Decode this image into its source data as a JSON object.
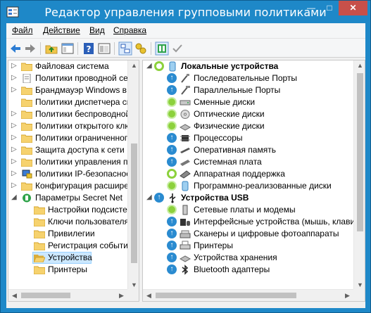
{
  "window": {
    "title": "Редактор управления групповыми политиками",
    "controls": {
      "minimize": "—",
      "maximize": "□",
      "close": "✕"
    },
    "colors": {
      "frame": "#1e88c8",
      "close": "#c7504a",
      "selection": "#cce8ff"
    }
  },
  "menubar": {
    "file": "Файл",
    "action": "Действие",
    "view": "Вид",
    "help": "Справка"
  },
  "toolbar": {
    "icons": [
      "back-arrow-icon",
      "forward-arrow-icon",
      "up-folder-icon",
      "show-hide-tree-icon",
      "help-icon",
      "properties-icon",
      "policy-tree-icon",
      "key-filter-icon",
      "view-toggle-icon",
      "checkmark-icon"
    ]
  },
  "left_tree": {
    "items": [
      {
        "label": "Файловая система",
        "expandable": true
      },
      {
        "label": "Политики проводной сети",
        "expandable": true
      },
      {
        "label": "Брандмауэр Windows в режиме повышенной безопасности",
        "expandable": true
      },
      {
        "label": "Политики диспетчера списков сетей",
        "expandable": false
      },
      {
        "label": "Политики беспроводной сети",
        "expandable": true
      },
      {
        "label": "Политики открытого ключа",
        "expandable": true
      },
      {
        "label": "Политики ограниченного использования программ",
        "expandable": true
      },
      {
        "label": "Защита доступа к сети",
        "expandable": true
      },
      {
        "label": "Политики управления приложениями",
        "expandable": true
      },
      {
        "label": "Политики IP-безопасности",
        "expandable": true
      },
      {
        "label": "Конфигурация расширенной политики аудита",
        "expandable": true
      },
      {
        "label": "Параметры Secret Net",
        "expandable": true,
        "expanded": true
      },
      {
        "label": "Настройки подсистем",
        "child": true
      },
      {
        "label": "Ключи пользователя",
        "child": true
      },
      {
        "label": "Привилегии",
        "child": true
      },
      {
        "label": "Регистрация событий",
        "child": true
      },
      {
        "label": "Устройства",
        "child": true,
        "selected": true
      },
      {
        "label": "Принтеры",
        "child": true
      }
    ]
  },
  "right_tree": {
    "items": [
      {
        "label": "Локальные устройства",
        "header": true,
        "status": "greenring",
        "icon": "local-devices-icon"
      },
      {
        "label": "Последовательные Порты",
        "status": "blue",
        "icon": "serial-port-icon"
      },
      {
        "label": "Параллельные Порты",
        "status": "blue",
        "icon": "parallel-port-icon"
      },
      {
        "label": "Сменные диски",
        "status": "green",
        "icon": "removable-disk-icon"
      },
      {
        "label": "Оптические диски",
        "status": "green",
        "icon": "optical-disk-icon"
      },
      {
        "label": "Физические диски",
        "status": "green",
        "icon": "physical-disk-icon"
      },
      {
        "label": "Процессоры",
        "status": "blue",
        "icon": "processor-icon"
      },
      {
        "label": "Оперативная память",
        "status": "blue",
        "icon": "memory-icon"
      },
      {
        "label": "Системная плата",
        "status": "blue",
        "icon": "motherboard-icon"
      },
      {
        "label": "Аппаратная поддержка",
        "status": "greenring",
        "icon": "hardware-support-icon"
      },
      {
        "label": "Программно-реализованные диски",
        "status": "green",
        "icon": "software-disk-icon"
      },
      {
        "label": "Устройства USB",
        "header": true,
        "status": "blue",
        "icon": "usb-icon"
      },
      {
        "label": "Сетевые платы и модемы",
        "status": "green",
        "icon": "network-card-icon"
      },
      {
        "label": "Интерфейсные устройства (мышь, клавиатура)",
        "status": "blue",
        "icon": "input-device-icon"
      },
      {
        "label": "Сканеры и цифровые фотоаппараты",
        "status": "blue",
        "icon": "scanner-icon"
      },
      {
        "label": "Принтеры",
        "status": "blue",
        "icon": "printer-icon"
      },
      {
        "label": "Устройства хранения",
        "status": "blue",
        "icon": "storage-icon"
      },
      {
        "label": "Bluetooth адаптеры",
        "status": "blue",
        "icon": "bluetooth-icon"
      }
    ]
  }
}
